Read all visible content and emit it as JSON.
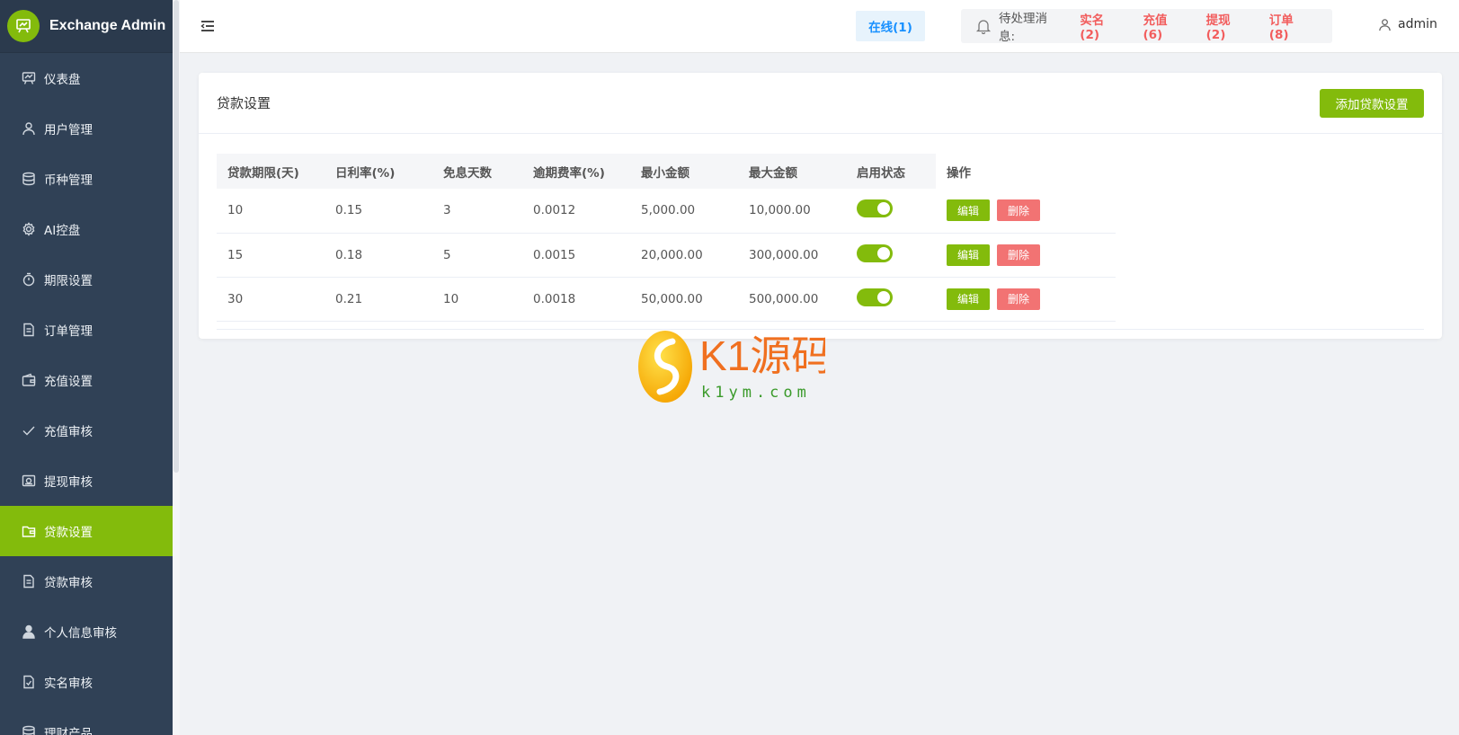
{
  "brand": {
    "title": "Exchange Admin"
  },
  "sidebar": {
    "items": [
      {
        "label": "仪表盘",
        "icon": "chart-board-icon"
      },
      {
        "label": "用户管理",
        "icon": "user-icon"
      },
      {
        "label": "币种管理",
        "icon": "database-icon"
      },
      {
        "label": "AI控盘",
        "icon": "gear-icon"
      },
      {
        "label": "期限设置",
        "icon": "timer-icon"
      },
      {
        "label": "订单管理",
        "icon": "document-icon"
      },
      {
        "label": "充值设置",
        "icon": "wallet-icon"
      },
      {
        "label": "充值审核",
        "icon": "check-icon"
      },
      {
        "label": "提现审核",
        "icon": "money-icon"
      },
      {
        "label": "贷款设置",
        "icon": "folder-icon",
        "active": true
      },
      {
        "label": "贷款审核",
        "icon": "document-icon"
      },
      {
        "label": "个人信息审核",
        "icon": "person-solid-icon"
      },
      {
        "label": "实名审核",
        "icon": "document-check-icon"
      },
      {
        "label": "理财产品",
        "icon": "database-icon"
      }
    ]
  },
  "header": {
    "online": "在线(1)",
    "notif_label": "待处理消息:",
    "notif_links": [
      "实名(2)",
      "充值(6)",
      "提现(2)",
      "订单(8)"
    ],
    "user": "admin"
  },
  "card": {
    "title": "贷款设置",
    "add_label": "添加贷款设置"
  },
  "table": {
    "headers": [
      "贷款期限(天)",
      "日利率(%)",
      "免息天数",
      "逾期费率(%)",
      "最小金额",
      "最大金额",
      "启用状态",
      "操作"
    ],
    "rows": [
      {
        "term": "10",
        "rate": "0.15",
        "free": "3",
        "overdue": "0.0012",
        "min": "5,000.00",
        "max": "10,000.00",
        "enabled": true
      },
      {
        "term": "15",
        "rate": "0.18",
        "free": "5",
        "overdue": "0.0015",
        "min": "20,000.00",
        "max": "300,000.00",
        "enabled": true
      },
      {
        "term": "30",
        "rate": "0.21",
        "free": "10",
        "overdue": "0.0018",
        "min": "50,000.00",
        "max": "500,000.00",
        "enabled": true
      }
    ],
    "edit_label": "编辑",
    "delete_label": "删除"
  },
  "watermark": {
    "text_main": "K1源码",
    "text_sub": "k1ym.com"
  },
  "colors": {
    "accent": "#83bb0c",
    "danger": "#f27373",
    "sidebar": "#304156",
    "link_red": "#f25d5d",
    "online_blue": "#1890ff"
  }
}
